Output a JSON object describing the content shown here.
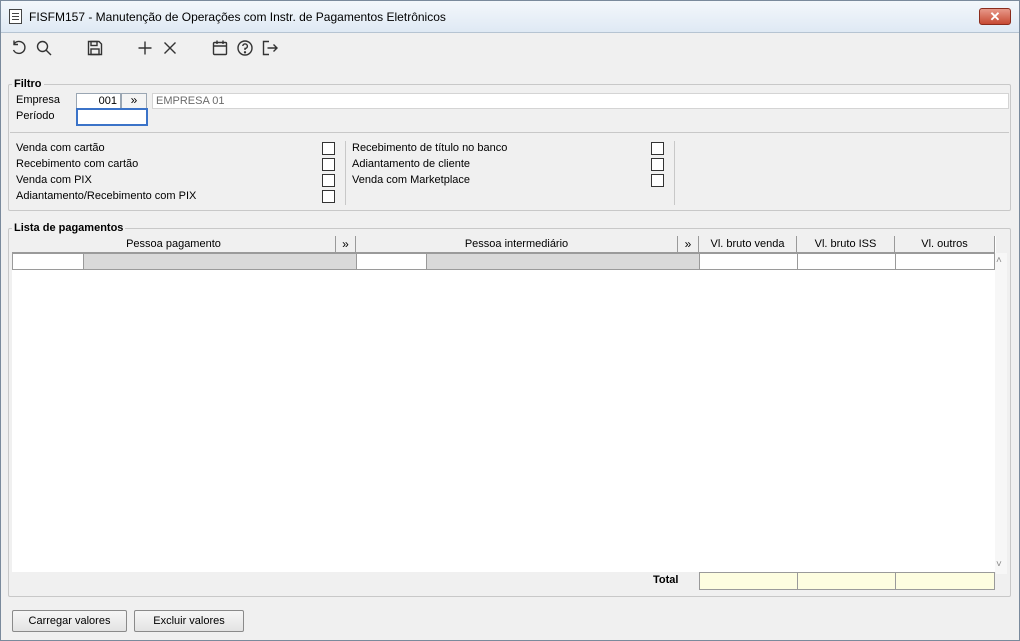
{
  "window": {
    "title": "FISFM157 - Manutenção de Operações com Instr. de Pagamentos Eletrônicos",
    "close_label": "✕"
  },
  "toolbar": {
    "icons": [
      "undo-icon",
      "search-icon",
      "save-icon",
      "add-icon",
      "delete-icon",
      "calendar-icon",
      "help-icon",
      "exit-icon"
    ]
  },
  "filtro": {
    "legend": "Filtro",
    "empresa_label": "Empresa",
    "empresa_code": "001",
    "lookup_label": "»",
    "empresa_name": "EMPRESA 01",
    "periodo_label": "Período",
    "periodo_value": ""
  },
  "options": {
    "left": [
      {
        "label": "Venda com cartão",
        "checked": false
      },
      {
        "label": "Recebimento com cartão",
        "checked": false
      },
      {
        "label": "Venda com PIX",
        "checked": false
      },
      {
        "label": "Adiantamento/Recebimento com PIX",
        "checked": false
      }
    ],
    "right": [
      {
        "label": "Recebimento de título no banco",
        "checked": false
      },
      {
        "label": "Adiantamento de cliente",
        "checked": false
      },
      {
        "label": "Venda com Marketplace",
        "checked": false
      }
    ]
  },
  "lista": {
    "legend": "Lista de pagamentos",
    "columns": {
      "pessoa_pagamento": "Pessoa pagamento",
      "lookup1": "»",
      "pessoa_intermediario": "Pessoa intermediário",
      "lookup2": "»",
      "vl_bruto_venda": "Vl. bruto venda",
      "vl_bruto_iss": "Vl. bruto ISS",
      "vl_outros": "Vl. outros"
    },
    "scroll_up": "˄",
    "scroll_down": "˅",
    "total_label": "Total"
  },
  "buttons": {
    "carregar": "Carregar valores",
    "excluir": "Excluir valores"
  },
  "colors": {
    "focus_border": "#3b73c8",
    "total_bg": "#fdfde0",
    "close_bg": "#c74a33"
  }
}
